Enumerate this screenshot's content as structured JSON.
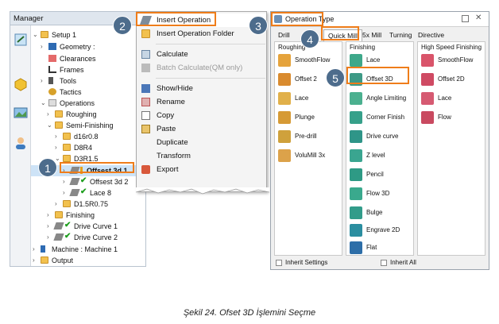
{
  "manager": {
    "title": "Manager",
    "tree": [
      {
        "label": "Setup 1"
      },
      {
        "label": "Geometry :"
      },
      {
        "label": "Clearances"
      },
      {
        "label": "Frames"
      },
      {
        "label": "Tools"
      },
      {
        "label": "Tactics"
      },
      {
        "label": "Operations"
      },
      {
        "label": "Roughing"
      },
      {
        "label": "Semi-Finishing"
      },
      {
        "label": "d16r0.8"
      },
      {
        "label": "D8R4"
      },
      {
        "label": "D3R1.5"
      },
      {
        "label": "Offsest 3d 1"
      },
      {
        "label": "Offsest 3d 2"
      },
      {
        "label": "Lace 8"
      },
      {
        "label": "D1.5R0.75"
      },
      {
        "label": "Finishing"
      },
      {
        "label": "Drive Curve 1"
      },
      {
        "label": "Drive Curve 2"
      },
      {
        "label": "Machine : Machine 1"
      },
      {
        "label": "Output"
      }
    ]
  },
  "context_menu": {
    "items": [
      {
        "label": "Insert Operation",
        "icon": "insert-operation-icon"
      },
      {
        "label": "Insert Operation Folder",
        "icon": "folder-icon"
      },
      {
        "label": "Calculate",
        "icon": "calculator-icon"
      },
      {
        "label": "Batch Calculate(QM only)",
        "icon": "batch-icon"
      },
      {
        "label": "Show/Hide",
        "icon": "show-hide-icon"
      },
      {
        "label": "Rename",
        "icon": "rename-icon"
      },
      {
        "label": "Copy",
        "icon": "copy-icon"
      },
      {
        "label": "Paste",
        "icon": "paste-icon"
      },
      {
        "label": "Duplicate",
        "icon": "duplicate-icon"
      },
      {
        "label": "Transform",
        "icon": "transform-icon"
      },
      {
        "label": "Export",
        "icon": "export-icon"
      }
    ]
  },
  "operation_type": {
    "title": "Operation Type",
    "tabs": [
      "Drill",
      "Quick Mill",
      "5x Mill",
      "Turning",
      "Directive"
    ],
    "active_tab": "Quick Mill",
    "columns": [
      {
        "header": "Roughing",
        "items": [
          "SmoothFlow",
          "Offset 2",
          "Lace",
          "Plunge",
          "Pre-drill",
          "VoluMill 3x"
        ]
      },
      {
        "header": "Finishing",
        "items": [
          "Lace",
          "Offset 3D",
          "Angle Limiting",
          "Corner Finish",
          "Drive curve",
          "Z level",
          "Pencil",
          "Flow 3D",
          "Bulge",
          "Engrave 2D",
          "Flat"
        ]
      },
      {
        "header": "High Speed Finishing",
        "items": [
          "SmoothFlow",
          "Offset 2D",
          "Lace",
          "Flow"
        ]
      }
    ],
    "inherit_settings": "Inherit Settings",
    "inherit_all": "Inherit All"
  },
  "steps": [
    "1",
    "2",
    "3",
    "4",
    "5"
  ],
  "caption": "Şekil 24. Ofset 3D İşlemini Seçme",
  "colors": {
    "highlight": "#ef7d1a",
    "badge": "#4d6c8c"
  }
}
